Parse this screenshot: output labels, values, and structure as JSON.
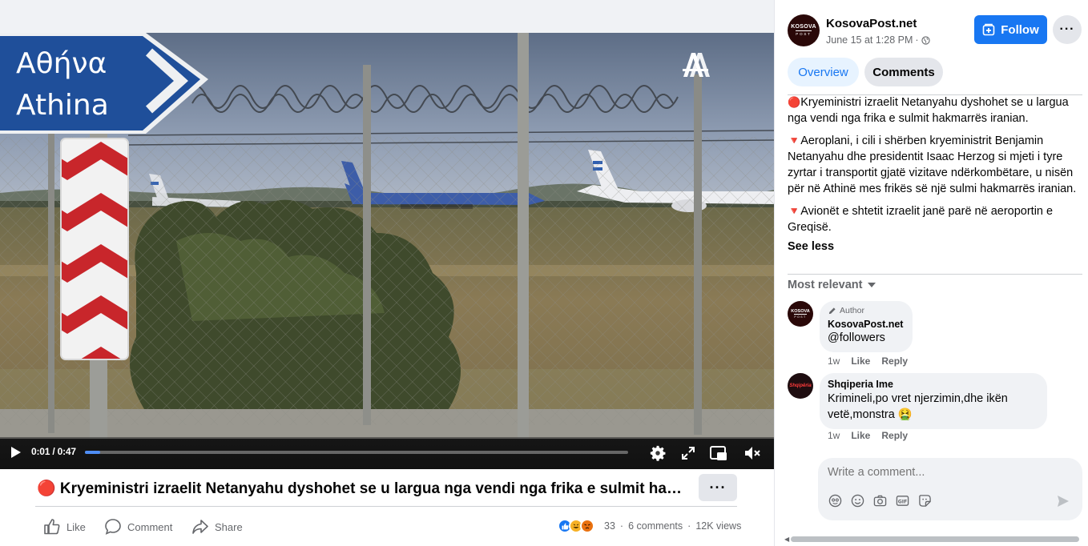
{
  "video": {
    "current_time": "0:01",
    "duration": "0:47",
    "time_separator": "/",
    "progress_fraction": 0.028,
    "watermark": "AA",
    "sign_greek": "Αθήνα",
    "sign_latin": "Athina",
    "icons": {
      "play": "play-icon",
      "settings": "gear-icon",
      "fullscreen": "expand-icon",
      "pip": "picture-in-picture-icon",
      "mute": "speaker-muted-icon"
    }
  },
  "post": {
    "title": "🔴 Kryeministri izraelit Netanyahu dyshohet se u largua nga vendi nga frika e sulmit hakmarrës iranian.",
    "more_label": "···",
    "actions": {
      "like": "Like",
      "comment": "Comment",
      "share": "Share"
    },
    "reaction_count": "33",
    "comments_count": "6 comments",
    "views": "12K views",
    "stats_separator": "·"
  },
  "page": {
    "name": "KosovaPost.net",
    "avatar_text_top": "KOSOVA",
    "avatar_text_bottom": "POST",
    "timestamp": "June 15 at 1:28 PM",
    "timestamp_separator": "·",
    "follow_label": "Follow",
    "more_label": "···"
  },
  "tabs": {
    "overview": "Overview",
    "comments": "Comments"
  },
  "body": {
    "paragraphs": [
      {
        "marker": "🔴",
        "text": "Kryeministri izraelit Netanyahu dyshohet se u largua nga vendi nga frika e sulmit hakmarrës iranian."
      },
      {
        "marker": "🔻",
        "text": "Aeroplani, i cili i shërben kryeministrit Benjamin Netanyahu dhe presidentit Isaac Herzog si mjeti i tyre zyrtar i transportit gjatë vizitave ndërkombëtare, u nisën për në Athinë mes frikës së një sulmi hakmarrës iranian."
      },
      {
        "marker": "🔻",
        "text": "Avionët e shtetit izraelit janë parë në aeroportin e Greqisë."
      }
    ],
    "see_less": "See less"
  },
  "comments_section": {
    "sort_label": "Most relevant",
    "items": [
      {
        "badge": "Author",
        "author": "KosovaPost.net",
        "text": "@followers",
        "age": "1w",
        "like": "Like",
        "reply": "Reply"
      },
      {
        "author": "Shqiperia Ime",
        "avatar_text": "Shqipëria",
        "text": "Krimineli,po vret njerzimin,dhe ikën vetë,monstra 🤮",
        "age": "1w",
        "like": "Like",
        "reply": "Reply"
      }
    ],
    "write_placeholder": "Write a comment..."
  },
  "colors": {
    "brand_blue": "#1877f2",
    "tab_active_bg": "#e7f3ff",
    "bubble_bg": "#f0f2f5",
    "muted_text": "#65676b",
    "progress": "#4e8df5"
  }
}
